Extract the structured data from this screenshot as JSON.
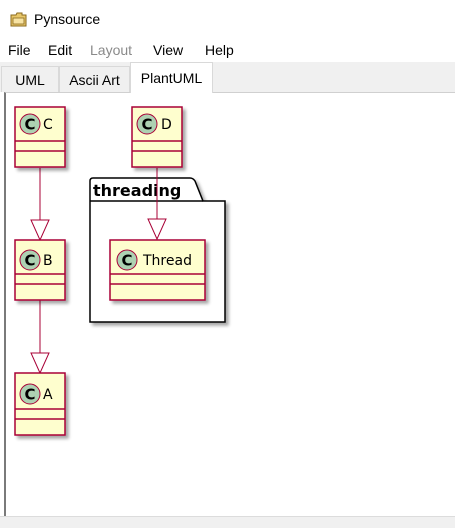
{
  "window": {
    "title": "Pynsource",
    "icon": "folder-icon"
  },
  "menu": [
    {
      "label": "File",
      "enabled": true
    },
    {
      "label": "Edit",
      "enabled": true
    },
    {
      "label": "Layout",
      "enabled": false
    },
    {
      "label": "View",
      "enabled": true
    },
    {
      "label": "Help",
      "enabled": true
    }
  ],
  "tabs": [
    {
      "label": "UML",
      "active": false
    },
    {
      "label": "Ascii Art",
      "active": false
    },
    {
      "label": "PlantUML",
      "active": true
    }
  ],
  "diagram": {
    "stereotype_letter": "C",
    "package": {
      "name": "threading"
    },
    "classes": {
      "c": "C",
      "d": "D",
      "b": "B",
      "a": "A",
      "thread": "Thread"
    },
    "colors": {
      "class_fill": "#FEFECE",
      "class_border": "#A80036",
      "stereotype_fill": "#ADD1B2",
      "package_border": "#000000"
    }
  }
}
